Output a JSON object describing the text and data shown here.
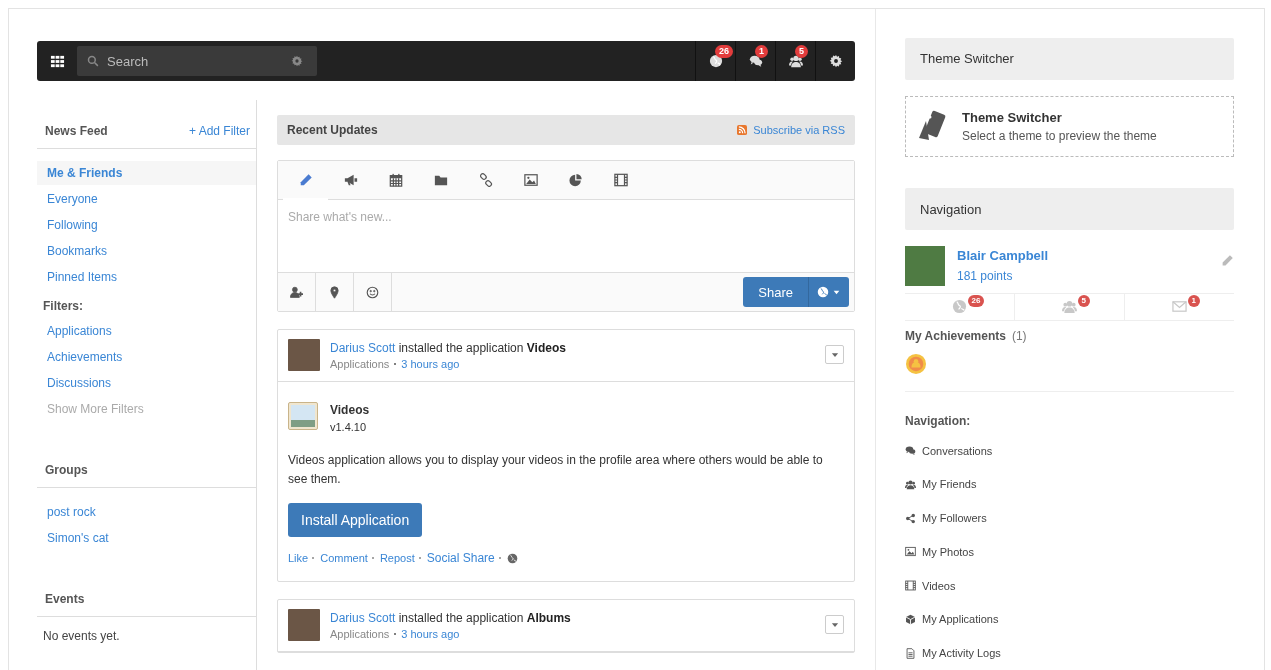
{
  "topbar": {
    "search": {
      "placeholder": "Search"
    },
    "notifications": [
      {
        "count": "26"
      },
      {
        "count": "1"
      },
      {
        "count": "5"
      }
    ]
  },
  "left_sidebar": {
    "title": "News Feed",
    "add_filter": "+ Add Filter",
    "feeds": [
      {
        "label": "Me & Friends",
        "selected": true
      },
      {
        "label": "Everyone",
        "selected": false
      },
      {
        "label": "Following",
        "selected": false
      },
      {
        "label": "Bookmarks",
        "selected": false
      },
      {
        "label": "Pinned Items",
        "selected": false
      }
    ],
    "filters_title": "Filters:",
    "filters": [
      {
        "label": "Applications",
        "disabled": false
      },
      {
        "label": "Achievements",
        "disabled": false
      },
      {
        "label": "Discussions",
        "disabled": false
      },
      {
        "label": "Show More Filters",
        "disabled": true
      }
    ],
    "groups_title": "Groups",
    "groups": [
      "post rock",
      "Simon's cat"
    ],
    "events_title": "Events",
    "events_empty": "No events yet."
  },
  "feed": {
    "title": "Recent Updates",
    "subscribe": "Subscribe via RSS",
    "composer": {
      "tabs": [
        {
          "selected": true
        },
        {
          "selected": false
        },
        {
          "selected": false
        },
        {
          "selected": false
        },
        {
          "selected": false
        },
        {
          "selected": false
        },
        {
          "selected": false
        },
        {
          "selected": false
        }
      ],
      "placeholder": "Share what's new...",
      "share": "Share"
    },
    "posts": [
      {
        "actor": "Darius Scott",
        "text": " installed the application **Videos**",
        "category": "Applications",
        "time": "3 hours ago",
        "app": {
          "name": "Videos",
          "version": "v1.4.10",
          "description": "Videos application allows you to display your videos in the profile area where others would be able to see them.",
          "install": "Install Application"
        },
        "actions": [
          "Like",
          "Comment",
          "Repost",
          "Social Share"
        ]
      },
      {
        "actor": "Darius Scott",
        "text": " installed the application **Albums**",
        "category": "Applications",
        "time": "3 hours ago"
      }
    ]
  },
  "right_sidebar": {
    "theme_header": "Theme Switcher",
    "theme_title": "Theme Switcher",
    "theme_desc": "Select a theme to preview the theme",
    "nav_header": "Navigation",
    "user": {
      "name": "Blair Campbell",
      "points": "181 points"
    },
    "counters": [
      {
        "count": "26"
      },
      {
        "count": "5"
      },
      {
        "count": "1"
      }
    ],
    "achievements": {
      "title": "My Achievements",
      "count": "(1)"
    },
    "nav_title": "Navigation:",
    "nav_items": [
      "Conversations",
      "My Friends",
      "My Followers",
      "My Photos",
      "Videos",
      "My Applications",
      "My Activity Logs"
    ]
  }
}
